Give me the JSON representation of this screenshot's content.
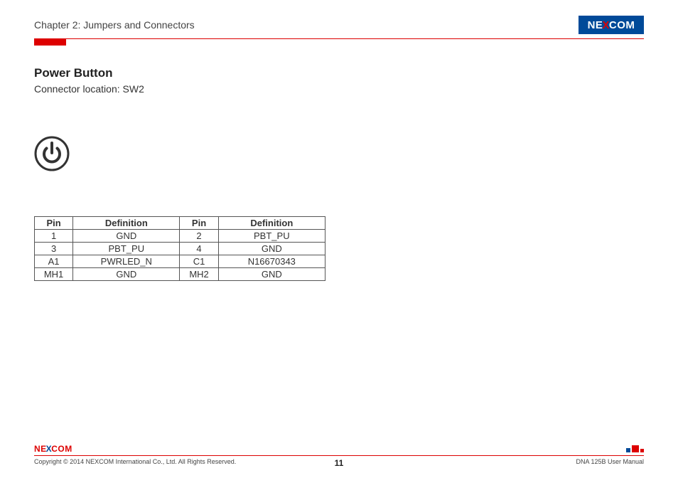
{
  "header": {
    "chapter": "Chapter 2: Jumpers and Connectors",
    "logo_left": "NE",
    "logo_x": "X",
    "logo_right": "COM"
  },
  "section": {
    "title": "Power Button",
    "subtitle": "Connector location: SW2"
  },
  "table": {
    "col1": "Pin",
    "col2": "Definition",
    "col3": "Pin",
    "col4": "Definition",
    "rows": [
      {
        "c1": "1",
        "c2": "GND",
        "c3": "2",
        "c4": "PBT_PU"
      },
      {
        "c1": "3",
        "c2": "PBT_PU",
        "c3": "4",
        "c4": "GND"
      },
      {
        "c1": "A1",
        "c2": "PWRLED_N",
        "c3": "C1",
        "c4": "N16670343"
      },
      {
        "c1": "MH1",
        "c2": "GND",
        "c3": "MH2",
        "c4": "GND"
      }
    ]
  },
  "footer": {
    "logo_left": "NE",
    "logo_x": "X",
    "logo_right": "COM",
    "copyright": "Copyright © 2014 NEXCOM International Co., Ltd. All Rights Reserved.",
    "page": "11",
    "manual": "DNA 125B User Manual"
  }
}
